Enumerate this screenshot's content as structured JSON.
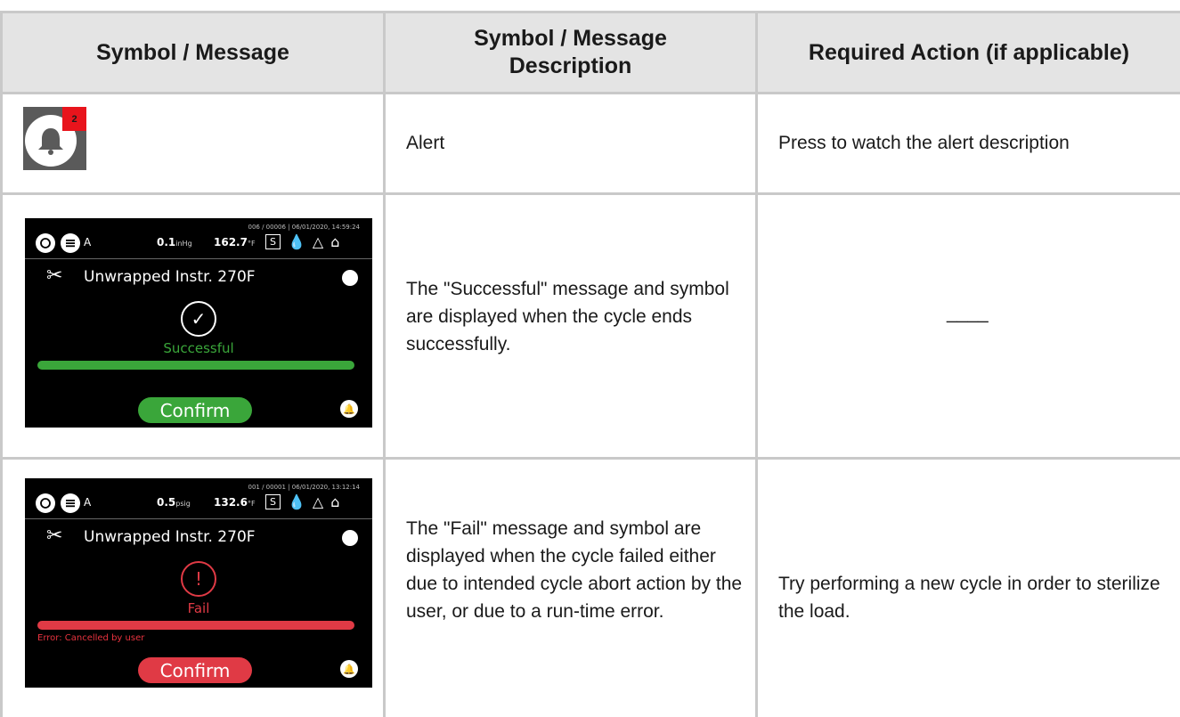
{
  "table": {
    "headers": {
      "col1": "Symbol / Message",
      "col2": "Symbol / Message Description",
      "col3": "Required Action (if applicable)"
    },
    "rows": [
      {
        "badge": "2",
        "description": "Alert",
        "action": "Press to watch the alert description"
      },
      {
        "screen": {
          "meta": "006 / 00006  |  06/01/2020, 14:59:24",
          "mode": "A",
          "pressure_value": "0.1",
          "pressure_unit": "inHg",
          "temp_value": "162.7",
          "temp_unit": "°F",
          "s_label": "S",
          "cycle_name": "Unwrapped Instr. 270F",
          "status_text": "Successful",
          "status_color": "#3aa63a",
          "confirm_label": "Confirm"
        },
        "description": "The \"Successful\" message and symbol are displayed when the cycle ends successfully.",
        "action": "____"
      },
      {
        "screen": {
          "meta": "001 / 00001  |  06/01/2020, 13:12:14",
          "mode": "A",
          "pressure_value": "0.5",
          "pressure_unit": "psig",
          "temp_value": "132.6",
          "temp_unit": "°F",
          "s_label": "S",
          "cycle_name": "Unwrapped Instr. 270F",
          "status_text": "Fail",
          "status_color": "#e03a45",
          "error_text": "Error: Cancelled by user",
          "confirm_label": "Confirm"
        },
        "description": "The \"Fail\" message and symbol are displayed when the cycle failed either due to intended cycle abort action by the user, or due to a run-time error.",
        "action": "Try performing a new cycle in order to sterilize the load."
      }
    ]
  }
}
